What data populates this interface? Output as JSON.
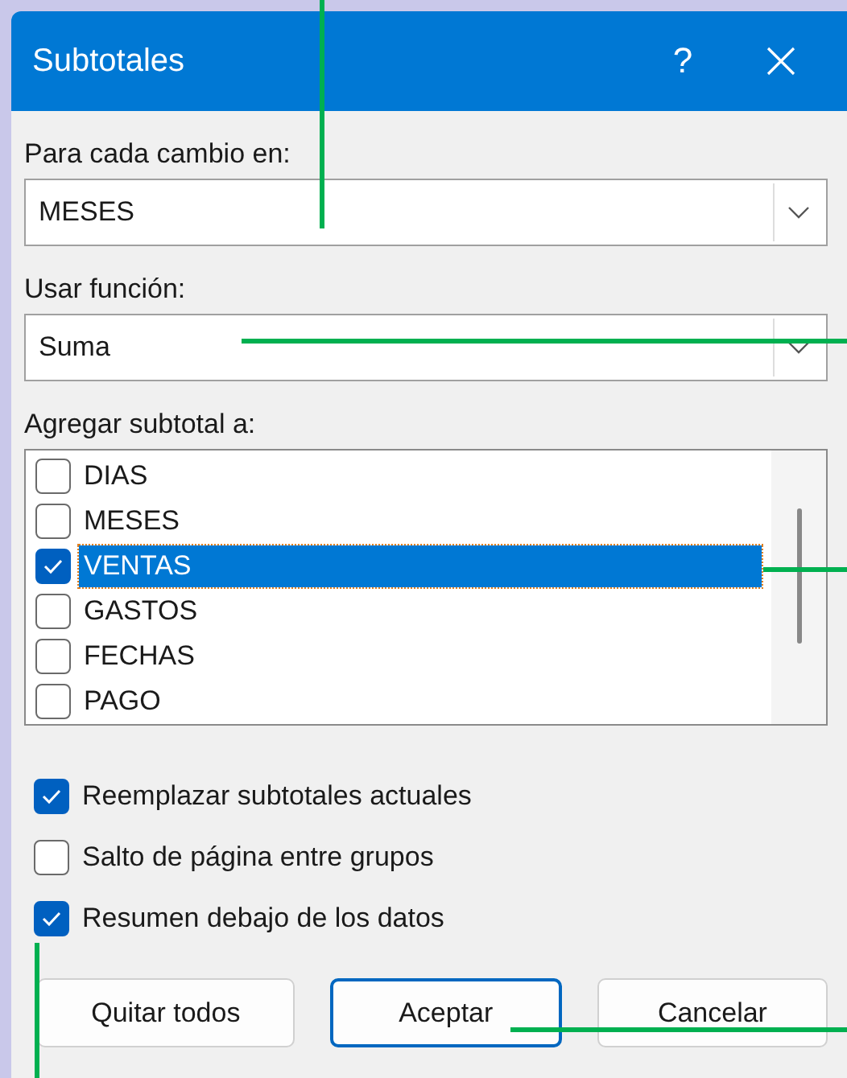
{
  "window": {
    "title": "Subtotales",
    "help": "?"
  },
  "fields": [
    {
      "label": "Para cada cambio en:",
      "value": "MESES"
    },
    {
      "label": "Usar función:",
      "value": "Suma"
    }
  ],
  "list": {
    "label": "Agregar subtotal a:",
    "items": [
      {
        "label": "DIAS",
        "checked": false,
        "selected": false
      },
      {
        "label": "MESES",
        "checked": false,
        "selected": false
      },
      {
        "label": "VENTAS",
        "checked": true,
        "selected": true
      },
      {
        "label": "GASTOS",
        "checked": false,
        "selected": false
      },
      {
        "label": "FECHAS",
        "checked": false,
        "selected": false
      },
      {
        "label": "PAGO",
        "checked": false,
        "selected": false
      }
    ]
  },
  "options": [
    {
      "label": "Reemplazar subtotales actuales",
      "checked": true
    },
    {
      "label": "Salto de página entre grupos",
      "checked": false
    },
    {
      "label": "Resumen debajo de los datos",
      "checked": true
    }
  ],
  "buttons": [
    {
      "label": "Quitar todos",
      "default": false
    },
    {
      "label": "Aceptar",
      "default": true
    },
    {
      "label": "Cancelar",
      "default": false
    }
  ]
}
